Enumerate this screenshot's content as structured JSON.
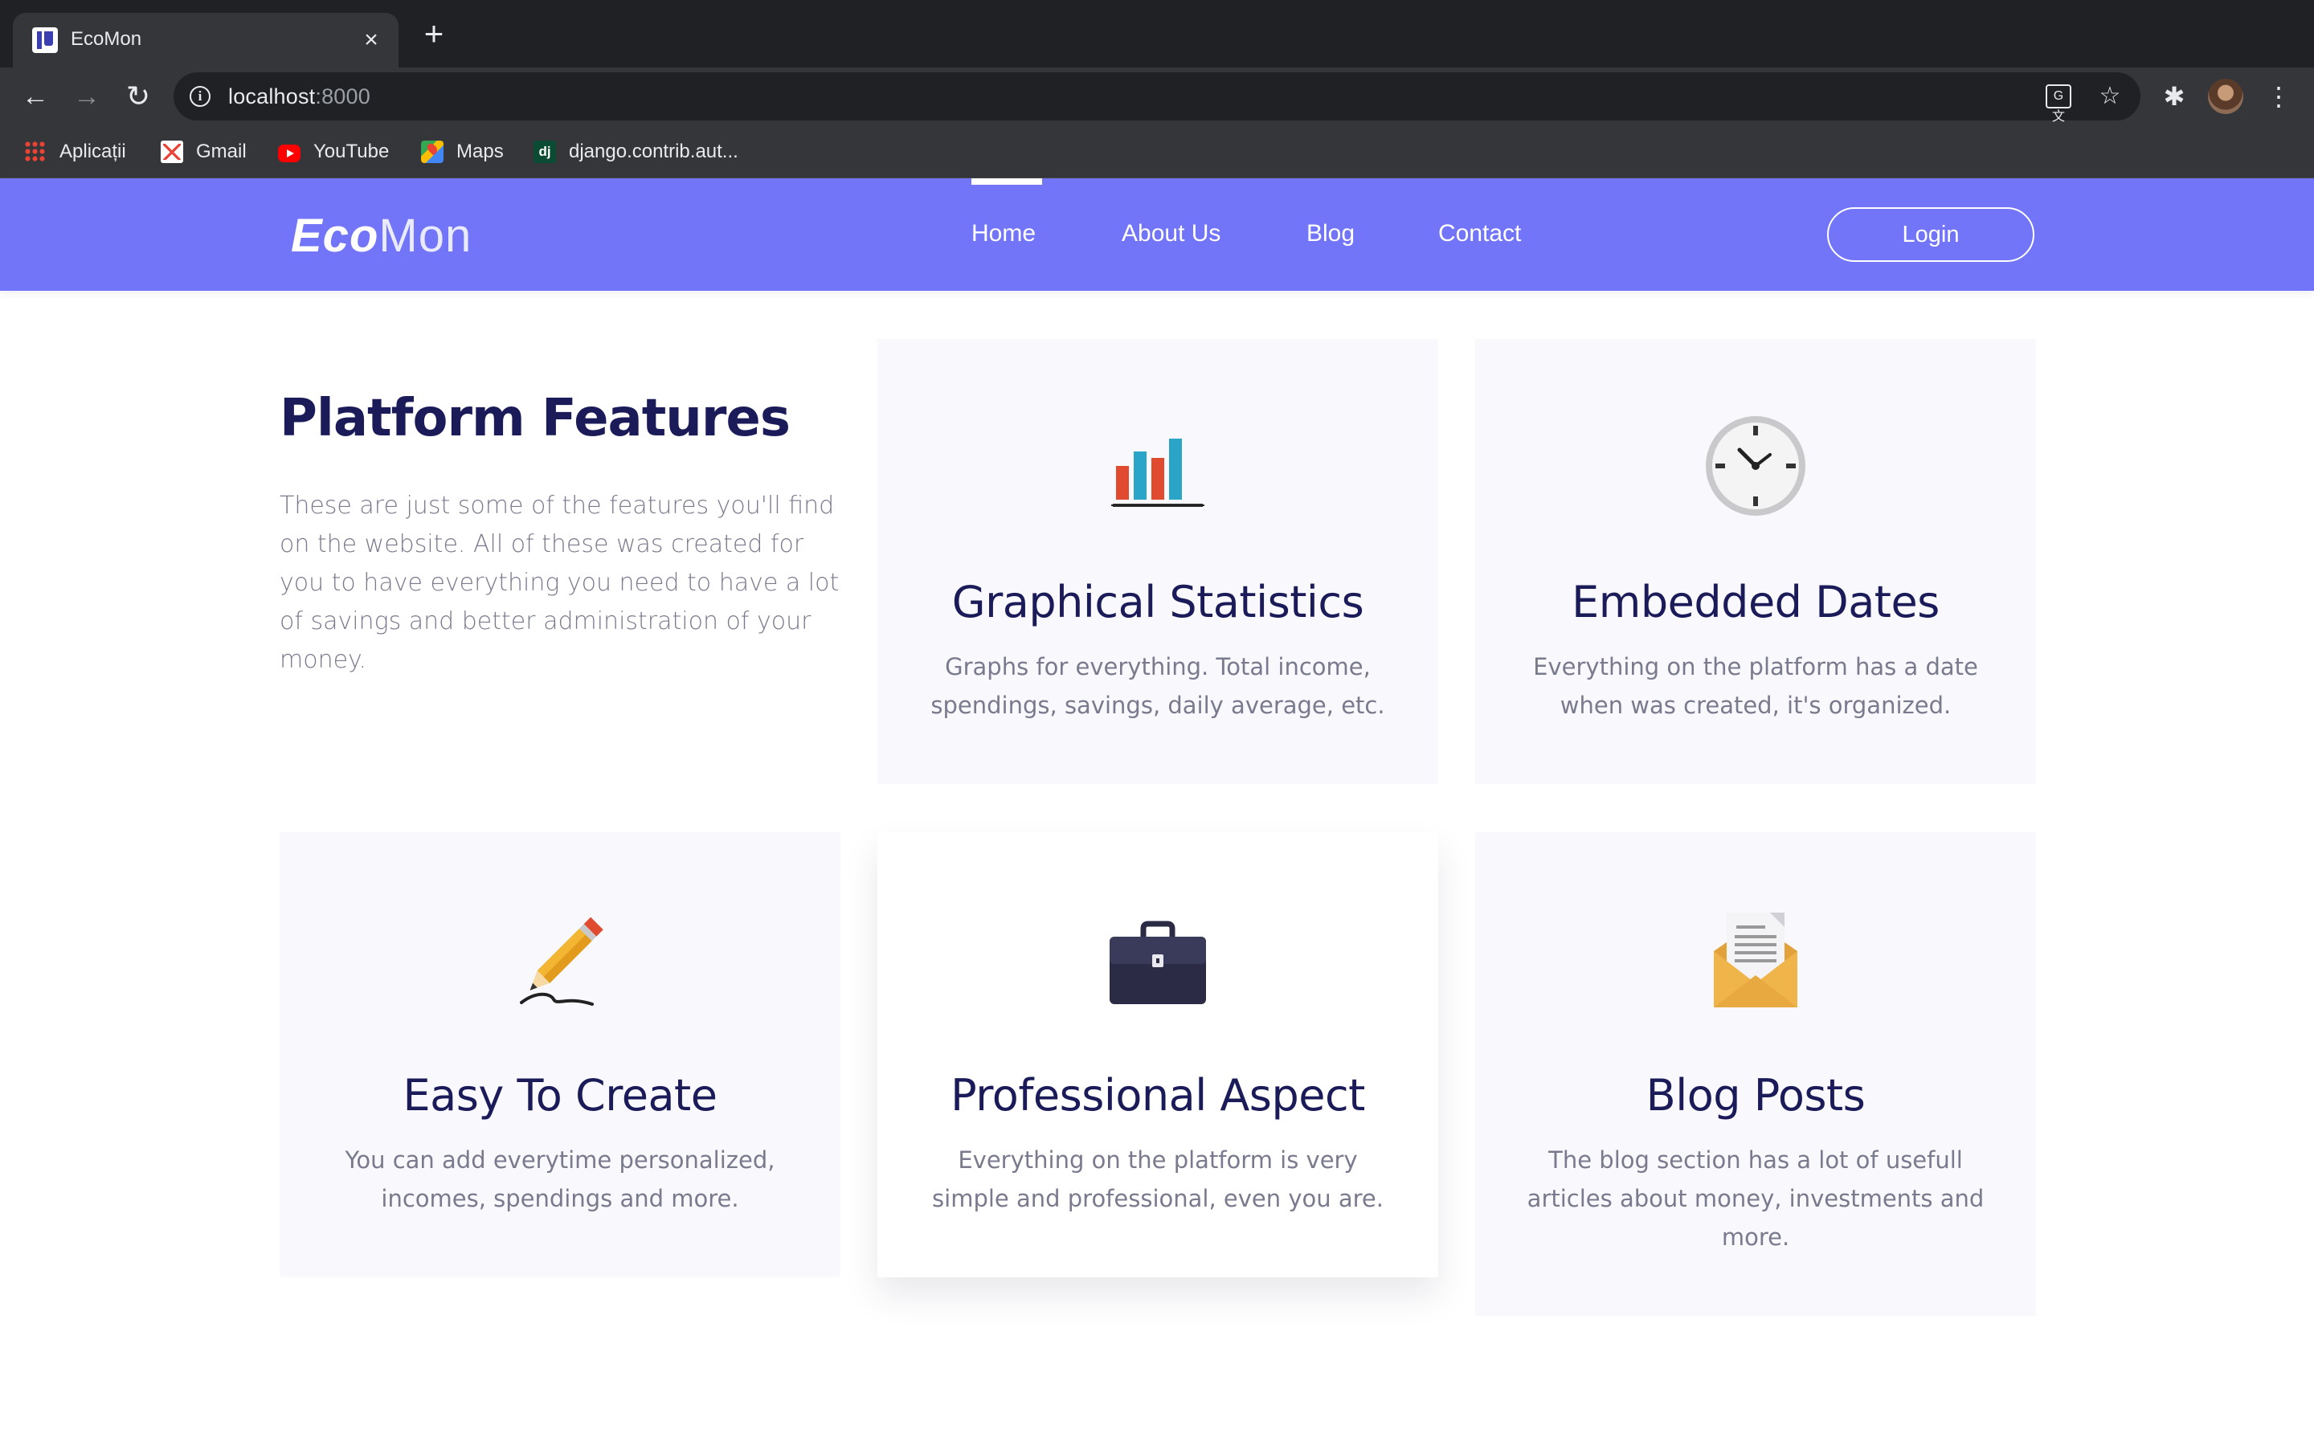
{
  "browser": {
    "tab_title": "EcoMon",
    "url_host": "localhost",
    "url_port": ":8000",
    "bookmarks": [
      "Aplicații",
      "Gmail",
      "YouTube",
      "Maps",
      "django.contrib.aut..."
    ]
  },
  "site": {
    "logo_eco": "Eco",
    "logo_mon": "Mon",
    "nav": [
      "Home",
      "About Us",
      "Blog",
      "Contact"
    ],
    "active_nav": "Home",
    "login_label": "Login",
    "brand_color": "#7275f7"
  },
  "features": {
    "title": "Platform Features",
    "intro": "These are just some of the features you'll find on the website. All of these was created for you to have everything you need to have a lot of savings and better administration of your money.",
    "cards": [
      {
        "icon": "bar-chart-icon",
        "title": "Graphical Statistics",
        "text": "Graphs for everything. Total income, spendings, savings, daily average, etc."
      },
      {
        "icon": "clock-icon",
        "title": "Embedded Dates",
        "text": "Everything on the platform has a date when was created, it's organized."
      },
      {
        "icon": "pencil-icon",
        "title": "Easy To Create",
        "text": "You can add everytime personalized, incomes, spendings and more."
      },
      {
        "icon": "briefcase-icon",
        "title": "Professional Aspect",
        "text": "Everything on the platform is very simple and professional, even you are."
      },
      {
        "icon": "envelope-letter-icon",
        "title": "Blog Posts",
        "text": "The blog section has a lot of usefull articles about money, investments and more."
      }
    ]
  }
}
